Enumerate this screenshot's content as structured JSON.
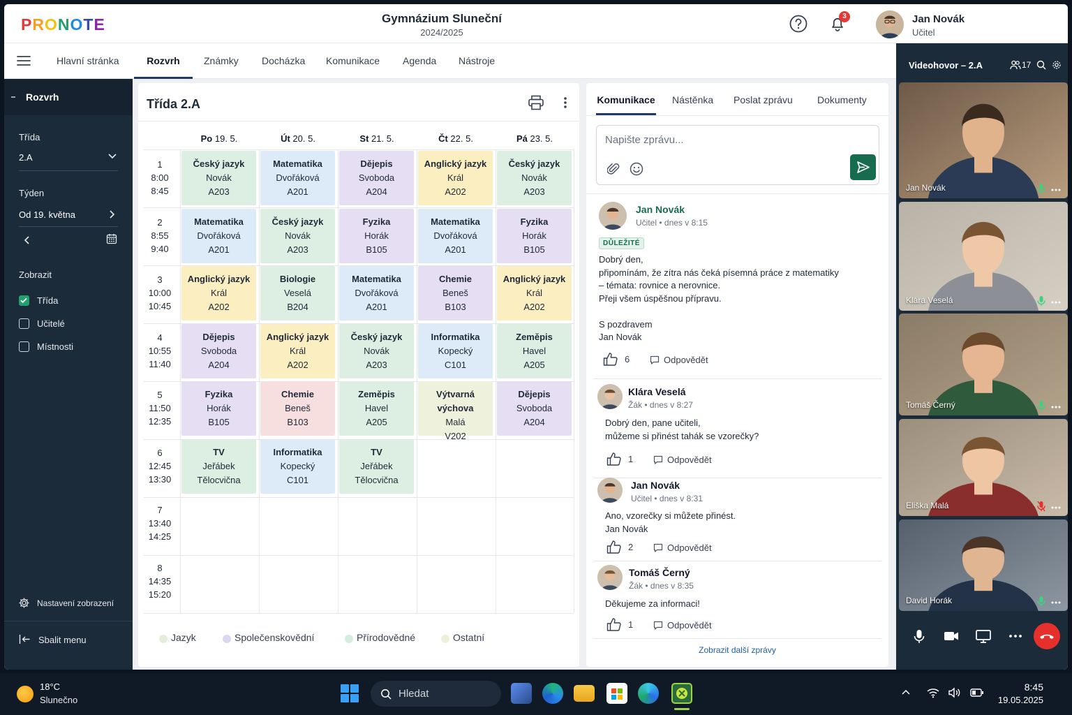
{
  "header": {
    "logo_letters": [
      "P",
      "R",
      "O",
      "N",
      "O",
      "T",
      "E"
    ],
    "logo_colors": [
      "#e53935",
      "#f4a020",
      "#f4c20d",
      "#22a06b",
      "#1e88e5",
      "#3949ab",
      "#8e24aa"
    ],
    "school_name": "Gymnázium Sluneční",
    "school_year": "2024/2025",
    "notification_count": "3",
    "user_name": "Jan Novák",
    "user_role": "Učitel"
  },
  "nav": {
    "items": [
      "Hlavní stránka",
      "Rozvrh",
      "Známky",
      "Docházka",
      "Komunikace",
      "Agenda",
      "Nástroje"
    ],
    "active": "Rozvrh"
  },
  "sidebar": {
    "section_title": "Rozvrh",
    "class_label": "Třída",
    "class_value": "2.A",
    "week_label": "Týden",
    "week_value": "Od 19. května",
    "display_label": "Zobrazit",
    "checks": [
      {
        "label": "Třída",
        "checked": true
      },
      {
        "label": "Učitelé",
        "checked": false
      },
      {
        "label": "Místnosti",
        "checked": false
      }
    ],
    "settings_label": "Nastavení zobrazení",
    "collapse_label": "Sbalit menu"
  },
  "timetable": {
    "title": "Třída 2.A",
    "days": [
      {
        "abbr": "Po",
        "date": "19. 5."
      },
      {
        "abbr": "Út",
        "date": "20. 5."
      },
      {
        "abbr": "St",
        "date": "21. 5."
      },
      {
        "abbr": "Čt",
        "date": "22. 5."
      },
      {
        "abbr": "Pá",
        "date": "23. 5."
      }
    ],
    "periods": [
      {
        "n": "1",
        "start": "8:00",
        "end": "8:45"
      },
      {
        "n": "2",
        "start": "8:55",
        "end": "9:40"
      },
      {
        "n": "3",
        "start": "10:00",
        "end": "10:45"
      },
      {
        "n": "4",
        "start": "10:55",
        "end": "11:40"
      },
      {
        "n": "5",
        "start": "11:50",
        "end": "12:35"
      },
      {
        "n": "6",
        "start": "12:45",
        "end": "13:30"
      },
      {
        "n": "7",
        "start": "13:40",
        "end": "14:25"
      },
      {
        "n": "8",
        "start": "14:35",
        "end": "15:20"
      }
    ],
    "colors": {
      "jazyk": "#fbeec0",
      "spol": "#e6def3",
      "prir": "#dcefe2",
      "mat": "#dcebf7",
      "chem": "#f7dfe0",
      "ost": "#eef1dc"
    },
    "lessons": [
      [
        {
          "s": "Český jazyk",
          "t": "Novák",
          "r": "A203",
          "c": "prir"
        },
        {
          "s": "Matematika",
          "t": "Dvořáková",
          "r": "A201",
          "c": "mat"
        },
        {
          "s": "Dějepis",
          "t": "Svoboda",
          "r": "A204",
          "c": "spol"
        },
        {
          "s": "Anglický jazyk",
          "t": "Král",
          "r": "A202",
          "c": "jazyk"
        },
        {
          "s": "Český jazyk",
          "t": "Novák",
          "r": "A203",
          "c": "prir"
        }
      ],
      [
        {
          "s": "Matematika",
          "t": "Dvořáková",
          "r": "A201",
          "c": "mat"
        },
        {
          "s": "Český jazyk",
          "t": "Novák",
          "r": "A203",
          "c": "prir"
        },
        {
          "s": "Fyzika",
          "t": "Horák",
          "r": "B105",
          "c": "spol"
        },
        {
          "s": "Matematika",
          "t": "Dvořáková",
          "r": "A201",
          "c": "mat"
        },
        {
          "s": "Fyzika",
          "t": "Horák",
          "r": "B105",
          "c": "spol"
        }
      ],
      [
        {
          "s": "Anglický jazyk",
          "t": "Král",
          "r": "A202",
          "c": "jazyk"
        },
        {
          "s": "Biologie",
          "t": "Veselá",
          "r": "B204",
          "c": "prir"
        },
        {
          "s": "Matematika",
          "t": "Dvořáková",
          "r": "A201",
          "c": "mat"
        },
        {
          "s": "Chemie",
          "t": "Beneš",
          "r": "B103",
          "c": "spol"
        },
        {
          "s": "Anglický jazyk",
          "t": "Král",
          "r": "A202",
          "c": "jazyk"
        }
      ],
      [
        {
          "s": "Dějepis",
          "t": "Svoboda",
          "r": "A204",
          "c": "spol"
        },
        {
          "s": "Anglický jazyk",
          "t": "Král",
          "r": "A202",
          "c": "jazyk"
        },
        {
          "s": "Český jazyk",
          "t": "Novák",
          "r": "A203",
          "c": "prir"
        },
        {
          "s": "Informatika",
          "t": "Kopecký",
          "r": "C101",
          "c": "mat"
        },
        {
          "s": "Zeměpis",
          "t": "Havel",
          "r": "A205",
          "c": "prir"
        }
      ],
      [
        {
          "s": "Fyzika",
          "t": "Horák",
          "r": "B105",
          "c": "spol"
        },
        {
          "s": "Chemie",
          "t": "Beneš",
          "r": "B103",
          "c": "chem"
        },
        {
          "s": "Zeměpis",
          "t": "Havel",
          "r": "A205",
          "c": "prir"
        },
        {
          "s": "Výtvarná výchova",
          "t": "Malá",
          "r": "V202",
          "c": "ost"
        },
        {
          "s": "Dějepis",
          "t": "Svoboda",
          "r": "A204",
          "c": "spol"
        }
      ],
      [
        {
          "s": "TV",
          "t": "Jeřábek",
          "r": "Tělocvična",
          "c": "prir"
        },
        {
          "s": "Informatika",
          "t": "Kopecký",
          "r": "C101",
          "c": "mat"
        },
        {
          "s": "TV",
          "t": "Jeřábek",
          "r": "Tělocvična",
          "c": "prir"
        },
        null,
        null
      ]
    ],
    "legend": [
      {
        "label": "Jazyk",
        "color": "#e3eed8"
      },
      {
        "label": "Společenskovědní",
        "color": "#ddd6f0"
      },
      {
        "label": "Přírodovědné",
        "color": "#d6ecdf"
      },
      {
        "label": "Ostatní",
        "color": "#eef0dc"
      }
    ]
  },
  "communication": {
    "tabs": [
      "Komunikace",
      "Nástěnka",
      "Poslat zprávu",
      "Dokumenty"
    ],
    "active_tab": "Komunikace",
    "composer_placeholder": "Napište zprávu...",
    "messages": [
      {
        "name": "Jan Novák",
        "role": "Učitel",
        "time": "dnes v 8:15",
        "tag": "DŮLEŽITÉ",
        "text": "Dobrý den,\npřipomínám, že zítra nás čeká písemná práce z matematiky\n– témata: rovnice a nerovnice.\nPřeji všem úspěšnou přípravu.\n\nS pozdravem\nJan Novák",
        "likes": "6",
        "reply": "Odpovědět"
      },
      {
        "name": "Klára Veselá",
        "role": "Žák",
        "time": "dnes v 8:27",
        "text": "Dobrý den, pane učiteli,\nmůžeme si přinést tahák se vzorečky?",
        "likes": "1",
        "reply": "Odpovědět"
      },
      {
        "name": "Jan Novák",
        "role": "Učitel",
        "time": "dnes v 8:31",
        "text": "Ano, vzorečky si můžete přinést.\nJan Novák",
        "likes": "2",
        "reply": "Odpovědět"
      },
      {
        "name": "Tomáš Černý",
        "role": "Žák",
        "time": "dnes v 8:35",
        "text": "Děkujeme za informaci!",
        "likes": "1",
        "reply": "Odpovědět"
      }
    ],
    "more_link": "Zobrazit další zprávy"
  },
  "video": {
    "title": "Videohovor – 2.A",
    "participant_count": "17",
    "participants": [
      {
        "name": "Jan Novák",
        "muted": false
      },
      {
        "name": "Klára Veselá",
        "muted": false
      },
      {
        "name": "Tomáš Černý",
        "muted": false
      },
      {
        "name": "Eliška Malá",
        "muted": true
      },
      {
        "name": "David Horák",
        "muted": false
      }
    ]
  },
  "taskbar": {
    "weather_temp": "18°C",
    "weather_desc": "Slunečno",
    "search_placeholder": "Hledat",
    "time": "8:45",
    "date": "19.05.2025"
  }
}
